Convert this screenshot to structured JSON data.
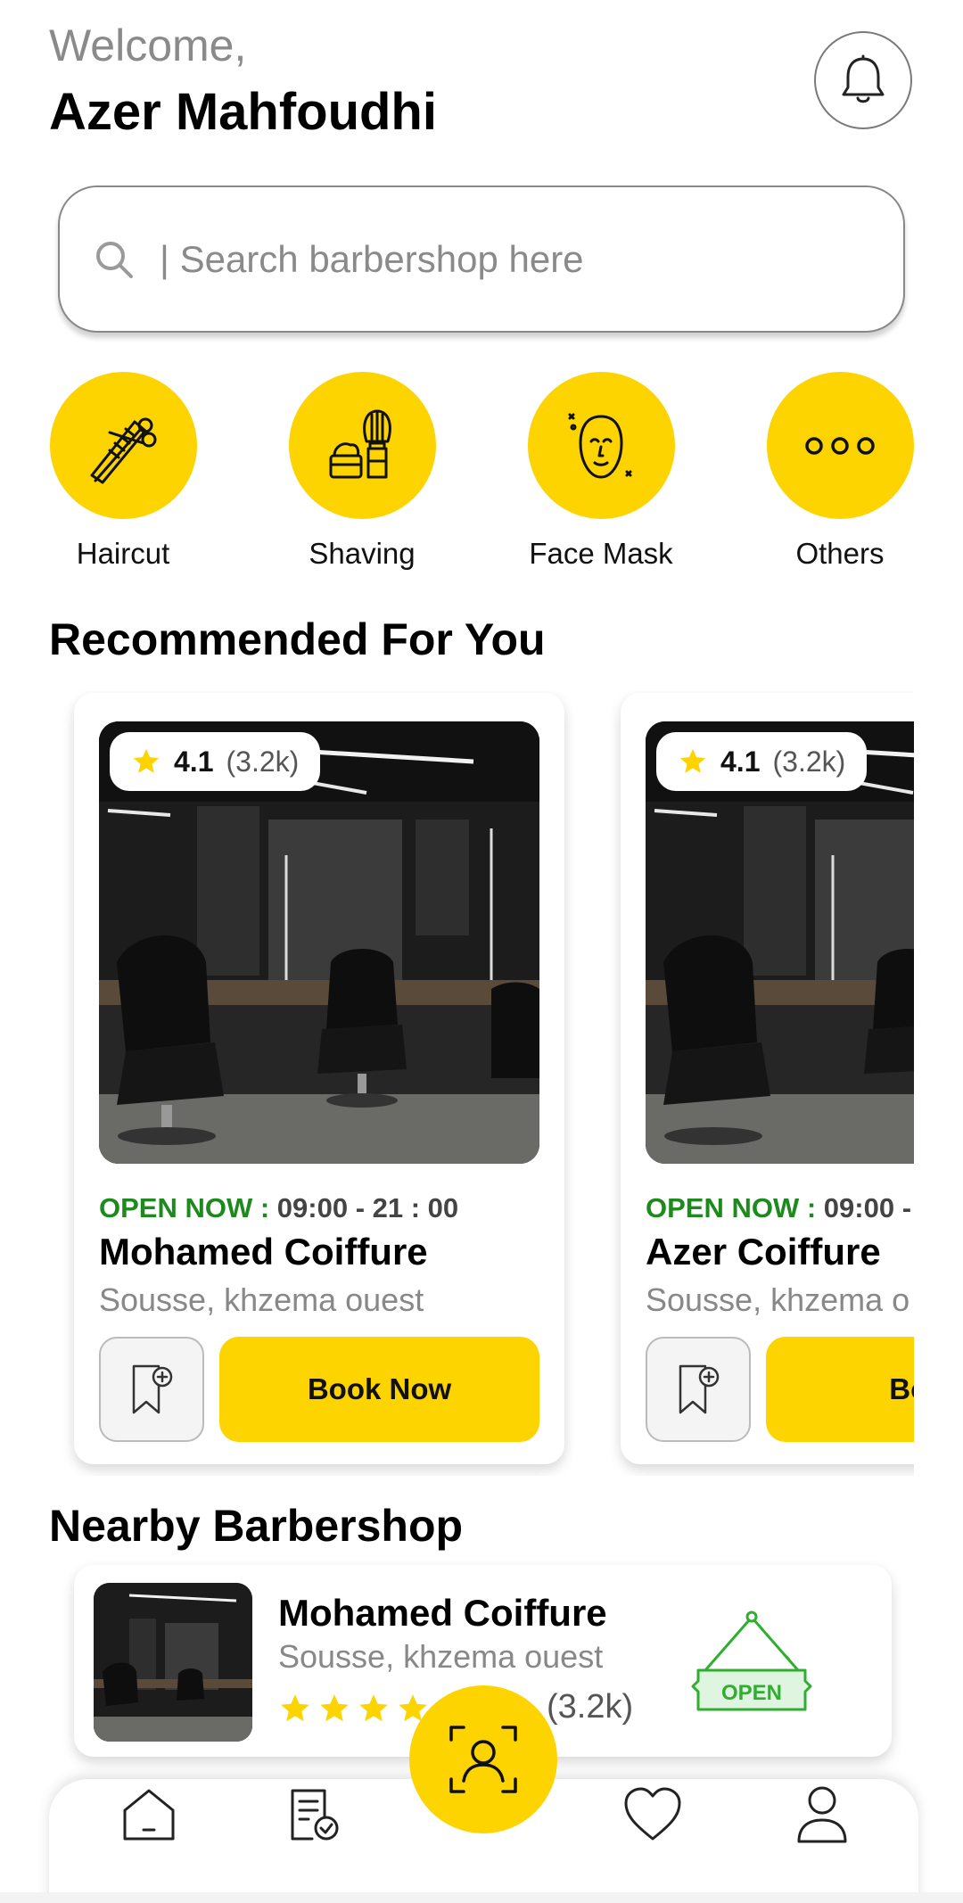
{
  "header": {
    "welcome": "Welcome,",
    "username": "Azer Mahfoudhi",
    "notification_icon": "bell-icon"
  },
  "search": {
    "placeholder": "| Search barbershop here",
    "icon": "search-icon"
  },
  "categories": [
    {
      "label": "Haircut",
      "icon": "scissors-comb-icon"
    },
    {
      "label": "Shaving",
      "icon": "shaving-brush-icon"
    },
    {
      "label": "Face Mask",
      "icon": "face-mask-icon"
    },
    {
      "label": "Others",
      "icon": "more-dots-icon"
    }
  ],
  "recommended": {
    "title": "Recommended For You",
    "cards": [
      {
        "rating": "4.1",
        "reviews": "(3.2k)",
        "open_label": "OPEN NOW :",
        "hours": "09:00 - 21 : 00",
        "name": "Mohamed Coiffure",
        "location": "Sousse, khzema ouest",
        "book_label": "Book Now"
      },
      {
        "rating": "4.1",
        "reviews": "(3.2k)",
        "open_label": "OPEN NOW :",
        "hours": "09:00 -",
        "name": "Azer Coiffure",
        "location": "Sousse, khzema o",
        "book_label": "Book"
      }
    ]
  },
  "nearby": {
    "title": "Nearby Barbershop",
    "shop": {
      "name": "Mohamed Coiffure",
      "location": "Sousse, khzema ouest",
      "stars": 5,
      "reviews": "(3.2k)",
      "status": "OPEN"
    }
  },
  "bottom_nav": {
    "items": [
      "home-icon",
      "bookings-icon",
      "scan-face-icon",
      "favorites-icon",
      "profile-icon"
    ]
  },
  "colors": {
    "accent": "#fdd400",
    "open_green": "#1e8a1e",
    "muted_text": "#8a8a8a"
  }
}
